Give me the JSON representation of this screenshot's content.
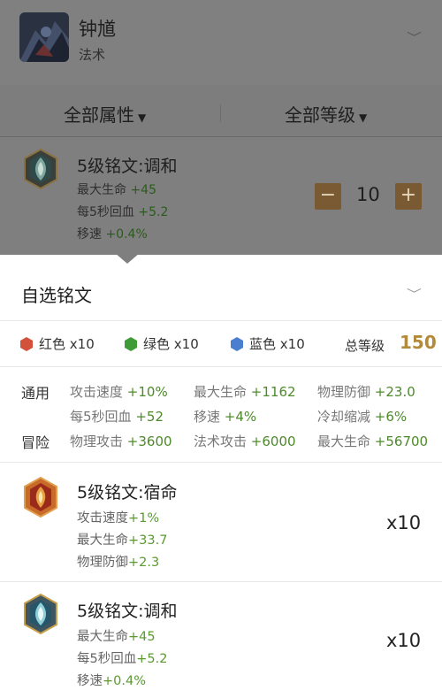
{
  "hero": {
    "name": "钟馗",
    "class": "法术"
  },
  "filters": {
    "attribute": "全部属性",
    "level": "全部等级"
  },
  "selected_rune": {
    "name": "5级铭文:调和",
    "stats": [
      {
        "label": "最大生命",
        "value": "+45"
      },
      {
        "label": "每5秒回血",
        "value": "+5.2"
      },
      {
        "label": "移速",
        "value": "+0.4%"
      }
    ],
    "count": "10",
    "minus": "−",
    "plus": "+"
  },
  "sheet": {
    "title": "自选铭文",
    "colors": [
      {
        "label": "红色 x10",
        "color": "#d3513a"
      },
      {
        "label": "绿色 x10",
        "color": "#3f9a38"
      },
      {
        "label": "蓝色 x10",
        "color": "#4a7fd0"
      }
    ],
    "total_label": "总等级",
    "total_value": "150",
    "summary": {
      "general_label": "通用",
      "adventure_label": "冒险",
      "general": [
        {
          "label": "攻击速度",
          "value": "+10%"
        },
        {
          "label": "最大生命",
          "value": "+1162"
        },
        {
          "label": "物理防御",
          "value": "+23.0"
        },
        {
          "label": "每5秒回血",
          "value": "+52"
        },
        {
          "label": "移速",
          "value": "+4%"
        },
        {
          "label": "冷却缩减",
          "value": "+6%"
        }
      ],
      "adventure": [
        {
          "label": "物理攻击",
          "value": "+3600"
        },
        {
          "label": "法术攻击",
          "value": "+6000"
        },
        {
          "label": "最大生命",
          "value": "+56700"
        }
      ]
    },
    "runes": [
      {
        "name": "5级铭文:宿命",
        "stats": [
          {
            "label": "攻击速度",
            "value": "+1%"
          },
          {
            "label": "最大生命",
            "value": "+33.7"
          },
          {
            "label": "物理防御",
            "value": "+2.3"
          }
        ],
        "count": "x10"
      },
      {
        "name": "5级铭文:调和",
        "stats": [
          {
            "label": "最大生命",
            "value": "+45"
          },
          {
            "label": "每5秒回血",
            "value": "+5.2"
          },
          {
            "label": "移速",
            "value": "+0.4%"
          }
        ],
        "count": "x10"
      }
    ]
  }
}
